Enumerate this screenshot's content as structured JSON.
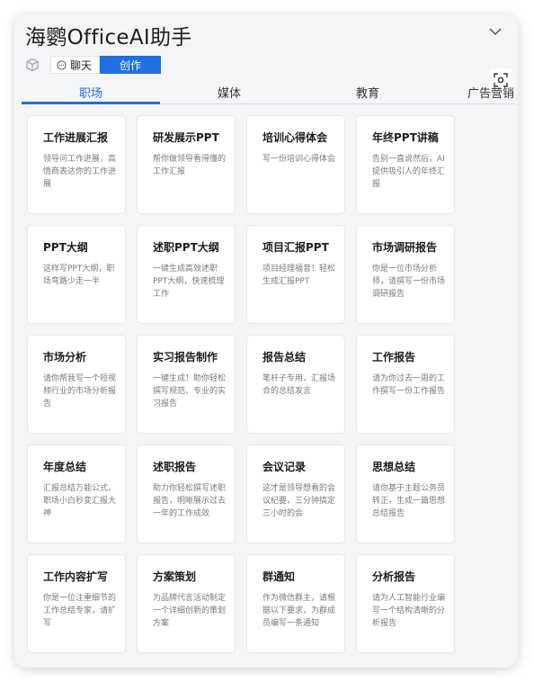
{
  "header": {
    "title": "海鹦OfficeAI助手",
    "collapse_icon": "chevron-down-icon"
  },
  "modes": {
    "cube_icon": "cube-icon",
    "chat_label": "聊天",
    "create_label": "创作",
    "active": "创作"
  },
  "screenshot_icon": "screenshot-scan-icon",
  "tabs": [
    {
      "label": "职场",
      "active": true
    },
    {
      "label": "媒体",
      "active": false
    },
    {
      "label": "教育",
      "active": false
    },
    {
      "label": "广告营销",
      "active": false
    }
  ],
  "cards": [
    {
      "title": "工作进展汇报",
      "desc": "领导问工作进展，高情商表达你的工作进展"
    },
    {
      "title": "研发展示PPT",
      "desc": "帮你做领导看得懂的工作汇报"
    },
    {
      "title": "培训心得体会",
      "desc": "写一份培训心得体会"
    },
    {
      "title": "年终PPT讲稿",
      "desc": "告别一直说然后，AI提供吸引人的年终汇报"
    },
    {
      "title": "PPT大纲",
      "desc": "这样写PPT大纲，职场弯路少走一半"
    },
    {
      "title": "述职PPT大纲",
      "desc": "一键生成高效述职PPT大纲，快速梳理工作"
    },
    {
      "title": "项目汇报PPT",
      "desc": "项目经理福音！轻松生成汇报PPT"
    },
    {
      "title": "市场调研报告",
      "desc": "你是一位市场分析师，请撰写一份市场调研报告"
    },
    {
      "title": "市场分析",
      "desc": "请你帮我写一个短视频行业的市场分析报告"
    },
    {
      "title": "实习报告制作",
      "desc": "一键生成！助你轻松撰写规范、专业的实习报告"
    },
    {
      "title": "报告总结",
      "desc": "笔杆子专用，汇报场合的总结发言"
    },
    {
      "title": "工作报告",
      "desc": "请为你过去一周的工作撰写一份工作报告"
    },
    {
      "title": "年度总结",
      "desc": "汇报总结万能公式，职场小白秒变汇报大神"
    },
    {
      "title": "述职报告",
      "desc": "助力你轻松撰写述职报告，明晰展示过去一年的工作成效"
    },
    {
      "title": "会议记录",
      "desc": "这才是领导想看的会议纪要，三分钟搞定三小时的会"
    },
    {
      "title": "思想总结",
      "desc": "请你基于主题公务员转正，生成一篇思想总结报告"
    },
    {
      "title": "工作内容扩写",
      "desc": "你是一位注重细节的工作总结专家，请扩写"
    },
    {
      "title": "方案策划",
      "desc": "为品牌代言活动制定一个详细创新的策划方案"
    },
    {
      "title": "群通知",
      "desc": "作为微信群主，请根据以下要求，为群成员编写一条通知"
    },
    {
      "title": "分析报告",
      "desc": "请为人工智能行业编写一个结构清晰的分析报告"
    }
  ],
  "colors": {
    "accent": "#1f6fe0",
    "panel_bg": "#f4f5f7",
    "card_bg": "#ffffff",
    "desc_text": "#7a7a80"
  }
}
